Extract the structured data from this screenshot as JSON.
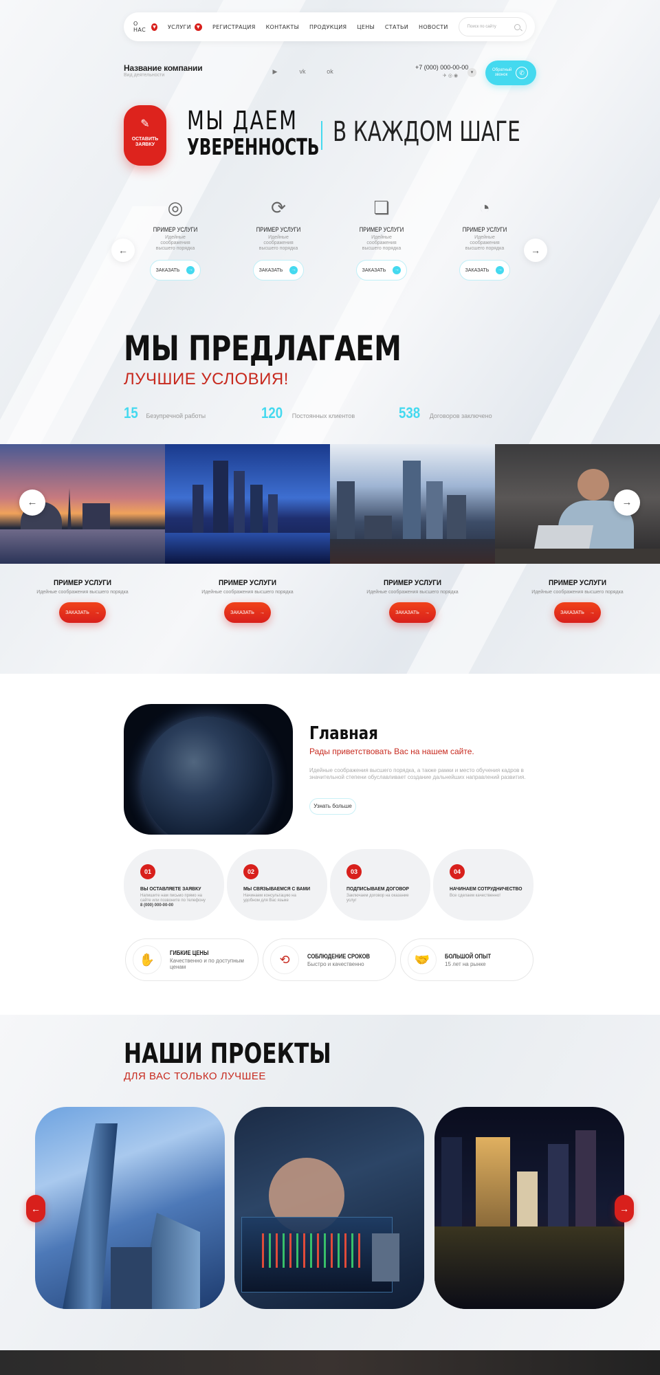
{
  "nav": {
    "items": [
      {
        "label": "О НАС",
        "dropdown": true
      },
      {
        "label": "УСЛУГИ",
        "dropdown": true
      },
      {
        "label": "РЕГИСТРАЦИЯ",
        "dropdown": false
      },
      {
        "label": "КОНТАКТЫ",
        "dropdown": false
      },
      {
        "label": "ПРОДУКЦИЯ",
        "dropdown": false
      },
      {
        "label": "ЦЕНЫ",
        "dropdown": false
      },
      {
        "label": "СТАТЬИ",
        "dropdown": false
      },
      {
        "label": "НОВОСТИ",
        "dropdown": false
      }
    ],
    "search_placeholder": "Поиск по сайту"
  },
  "header": {
    "company_name": "Название компании",
    "activity": "Вид деятельности",
    "social_icons": [
      "youtube-icon",
      "vk-icon",
      "odnoklassniki-icon"
    ],
    "phone": "+7 (000) 000-00-00",
    "callback_label": "Обратный звонок"
  },
  "hero": {
    "badge_label": "ОСТАВИТЬ ЗАЯВКУ",
    "line1": "МЫ ДАЕМ",
    "line2": "УВЕРЕННОСТЬ",
    "line3": "В КАЖДОМ ШАГЕ",
    "accent_color": "#44d9ef"
  },
  "services": [
    {
      "icon": "target-icon",
      "title": "ПРИМЕР УСЛУГИ",
      "desc": "Идейные соображения высшего порядка",
      "button": "ЗАКАЗАТЬ"
    },
    {
      "icon": "refresh-clock-icon",
      "title": "ПРИМЕР УСЛУГИ",
      "desc": "Идейные соображения высшего порядка",
      "button": "ЗАКАЗАТЬ"
    },
    {
      "icon": "document-search-icon",
      "title": "ПРИМЕР УСЛУГИ",
      "desc": "Идейные соображения высшего порядка",
      "button": "ЗАКАЗАТЬ"
    },
    {
      "icon": "pie-chart-icon",
      "title": "ПРИМЕР УСЛУГИ",
      "desc": "Идейные соображения высшего порядка",
      "button": "ЗАКАЗАТЬ"
    }
  ],
  "offer": {
    "title": "МЫ ПРЕДЛАГАЕМ",
    "subtitle": "ЛУЧШИЕ УСЛОВИЯ!",
    "stats": [
      {
        "value": "15",
        "label": "Безупречной работы"
      },
      {
        "value": "120",
        "label": "Постоянных клиентов"
      },
      {
        "value": "538",
        "label": "Договоров заключено"
      }
    ]
  },
  "cards": [
    {
      "title": "ПРИМЕР УСЛУГИ",
      "desc": "Идейные соображения высшего порядка",
      "button": "ЗАКАЗАТЬ"
    },
    {
      "title": "ПРИМЕР УСЛУГИ",
      "desc": "Идейные соображения высшего порядка",
      "button": "ЗАКАЗАТЬ"
    },
    {
      "title": "ПРИМЕР УСЛУГИ",
      "desc": "Идейные соображения высшего порядка",
      "button": "ЗАКАЗАТЬ"
    },
    {
      "title": "ПРИМЕР УСЛУГИ",
      "desc": "Идейные соображения высшего порядка",
      "button": "ЗАКАЗАТЬ"
    }
  ],
  "main": {
    "title": "Главная",
    "subtitle": "Рады приветствовать Вас на нашем сайте.",
    "text": "Идейные соображения высшего порядка, а также рамки и место обучения кадров в значительной степени обуславливает создание дальнейших направлений развития.",
    "more_button": "Узнать больше"
  },
  "steps": [
    {
      "num": "01",
      "title": "ВЫ ОСТАВЛЯЕТЕ ЗАЯВКУ",
      "desc": "Напишите нам письмо прямо на сайте или позвоните по телефону",
      "phone": "8 (000) 000-00-00"
    },
    {
      "num": "02",
      "title": "МЫ СВЯЗЫВАЕМСЯ С ВАМИ",
      "desc": "Начинаем консультацию на удобном для Вас языке",
      "phone": ""
    },
    {
      "num": "03",
      "title": "ПОДПИСЫВАЕМ ДОГОВОР",
      "desc": "Заключаем договор на оказание услуг",
      "phone": ""
    },
    {
      "num": "04",
      "title": "НАЧИНАЕМ СОТРУДНИЧЕСТВО",
      "desc": "Все сделаем качественно!",
      "phone": ""
    }
  ],
  "advantages": [
    {
      "icon": "hand-coin-icon",
      "title": "ГИБКИЕ ЦЕНЫ",
      "desc": "Качественно и по доступным ценам"
    },
    {
      "icon": "cycle-arrows-icon",
      "title": "СОБЛЮДЕНИЕ СРОКОВ",
      "desc": "Быстро и качественно"
    },
    {
      "icon": "handshake-icon",
      "title": "БОЛЬШОЙ ОПЫТ",
      "desc": "15 лет на рынке"
    }
  ],
  "projects": {
    "title": "НАШИ ПРОЕКТЫ",
    "subtitle": "ДЛЯ ВАС ТОЛЬКО ЛУЧШЕЕ"
  }
}
